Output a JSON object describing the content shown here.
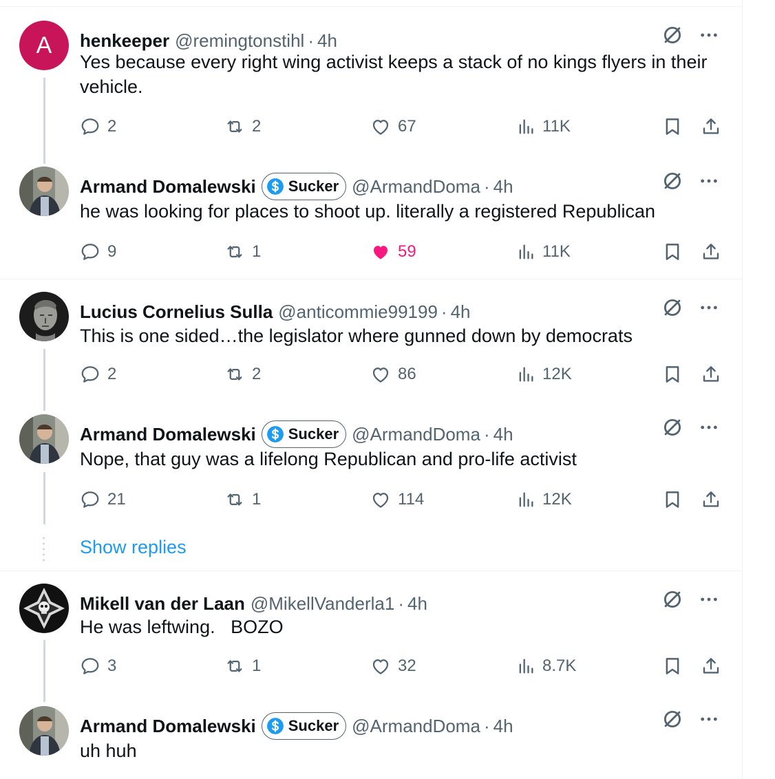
{
  "tweets": [
    {
      "name": "henkeeper",
      "handle": "@remingtonstihl",
      "time": "4h",
      "avatar_letter": "A",
      "text": "Yes because every right wing activist keeps a stack of no kings flyers in their vehicle.",
      "replies": "2",
      "reposts": "2",
      "likes": "67",
      "views": "11K",
      "liked": false
    },
    {
      "name": "Armand Domalewski",
      "badge": "Sucker",
      "handle": "@ArmandDoma",
      "time": "4h",
      "text": "he was looking for places to shoot up. literally a registered Republican",
      "replies": "9",
      "reposts": "1",
      "likes": "59",
      "views": "11K",
      "liked": true
    },
    {
      "name": "Lucius Cornelius Sulla",
      "handle": "@anticommie99199",
      "time": "4h",
      "text": "This is one sided…the legislator where gunned down by democrats",
      "replies": "2",
      "reposts": "2",
      "likes": "86",
      "views": "12K",
      "liked": false
    },
    {
      "name": "Armand Domalewski",
      "badge": "Sucker",
      "handle": "@ArmandDoma",
      "time": "4h",
      "text": "Nope, that guy was a lifelong Republican and pro-life activist",
      "replies": "21",
      "reposts": "1",
      "likes": "114",
      "views": "12K",
      "liked": false
    },
    {
      "name": "Mikell van der Laan",
      "handle": "@MikellVanderla1",
      "time": "4h",
      "text": "He was leftwing.   BOZO",
      "replies": "3",
      "reposts": "1",
      "likes": "32",
      "views": "8.7K",
      "liked": false
    },
    {
      "name": "Armand Domalewski",
      "badge": "Sucker",
      "handle": "@ArmandDoma",
      "time": "4h",
      "text": "uh huh"
    }
  ],
  "show_replies": "Show replies",
  "separator": "·",
  "colors": {
    "accent": "#1d9bf0",
    "like": "#f91880",
    "muted": "#536471",
    "avatar_a": "#c8155a"
  }
}
